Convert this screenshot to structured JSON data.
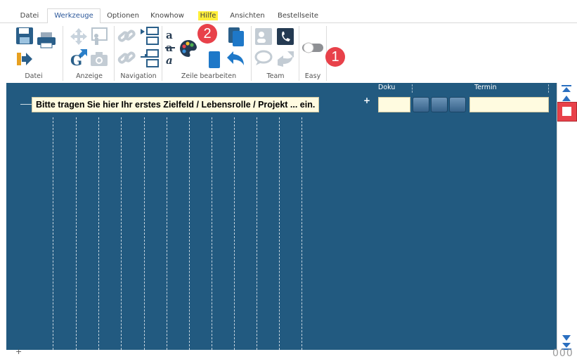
{
  "tabs": [
    "Datei",
    "Werkzeuge",
    "Optionen",
    "Knowhow",
    "Hilfe",
    "Ansichten",
    "Bestellseite"
  ],
  "active_tab": "Werkzeuge",
  "groups": [
    "Datei",
    "Anzeige",
    "Navigation",
    "Zeile bearbeiten",
    "Team",
    "Easy"
  ],
  "badges": [
    "1",
    "2"
  ],
  "workspace": {
    "entry_text": "Bitte tragen Sie hier Ihr erstes Zielfeld / Lebensrolle / Projekt ... ein.",
    "plus": "+",
    "col_doku": "Doku",
    "col_termin": "Termin"
  },
  "footer": {
    "plus": "+",
    "right": "000"
  },
  "colors": {
    "workspace_bg": "#225a80",
    "badge": "#e8414a",
    "field": "#fffbe0",
    "highlight": "#ffef3a"
  },
  "icons": [
    "save-icon",
    "print-icon",
    "exit-icon",
    "move-icon",
    "presentation-icon",
    "google-icon",
    "camera-icon",
    "link-icon",
    "split-icon",
    "link-icon-2",
    "merge-icon",
    "text-a-icon",
    "palette-icon",
    "blue-block-icon",
    "copy-icon",
    "undo-icon",
    "team-card-icon",
    "phone-icon",
    "chat-icon",
    "share-icon",
    "toggle-icon"
  ]
}
